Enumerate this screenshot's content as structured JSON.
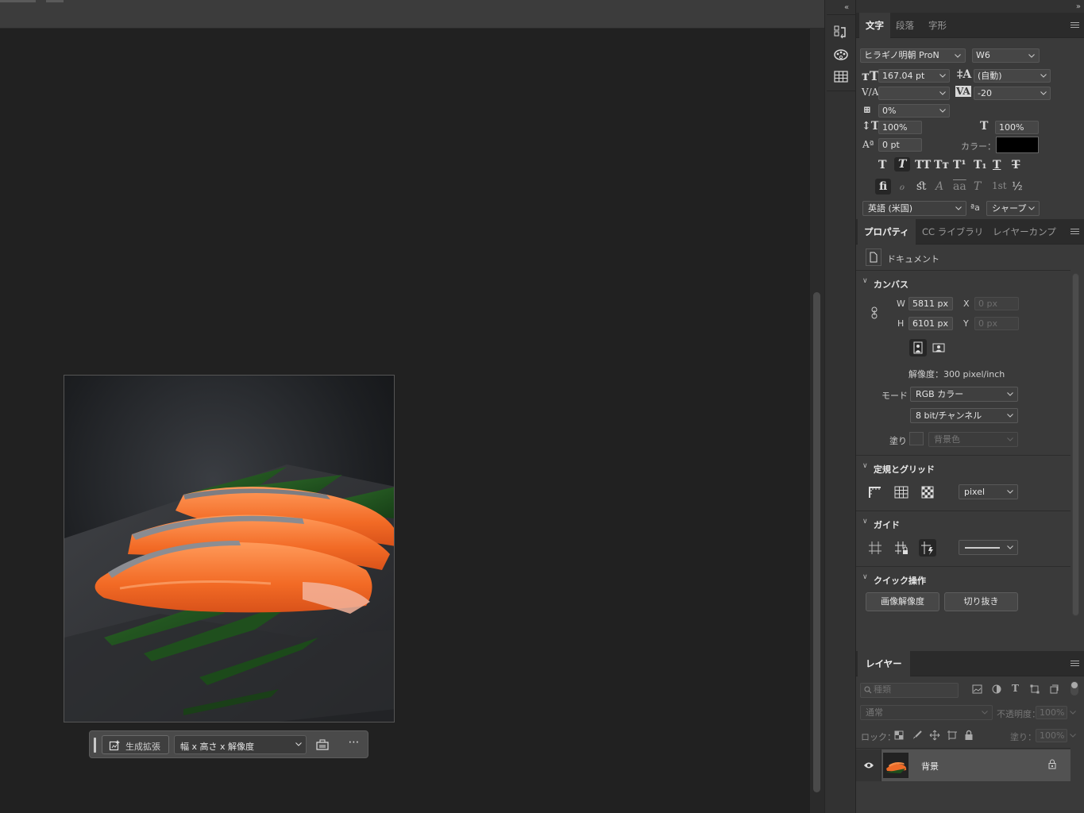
{
  "character_panel": {
    "tabs": [
      "文字",
      "段落",
      "字形"
    ],
    "font_family": "ヒラギノ明朝 ProN",
    "font_style": "W6",
    "font_size": "167.04 pt",
    "leading": "(自動)",
    "kerning": "",
    "tracking": "-20",
    "tsume": "0%",
    "vertical_scale": "100%",
    "horizontal_scale": "100%",
    "baseline_shift": "0 pt",
    "color_label": "カラー：",
    "color_value": "#000000",
    "language": "英語 (米国)",
    "antialias": "シャープ",
    "style_buttons": [
      "T",
      "T",
      "TT",
      "Tт",
      "T¹",
      "T₁",
      "T",
      "T"
    ],
    "opentype_buttons": [
      "ﬁ",
      "ℴ",
      "ﬆ",
      "A",
      "aa",
      "T",
      "1st",
      "½"
    ]
  },
  "properties_panel": {
    "tabs": [
      "プロパティ",
      "CC ライブラリ",
      "レイヤーカンプ"
    ],
    "document_label": "ドキュメント",
    "canvas": {
      "heading": "カンバス",
      "w_label": "W",
      "w_value": "5811 px",
      "h_label": "H",
      "h_value": "6101 px",
      "x_label": "X",
      "x_value": "0 px",
      "y_label": "Y",
      "y_value": "0 px",
      "resolution": "解像度：300 pixel/inch",
      "mode_label": "モード",
      "mode_value": "RGB カラー",
      "bit_depth": "8 bit/チャンネル",
      "fill_label": "塗り",
      "fill_value": "背景色"
    },
    "rulers": {
      "heading": "定規とグリッド",
      "unit": "pixel"
    },
    "guides": {
      "heading": "ガイド"
    },
    "quick_actions": {
      "heading": "クイック操作",
      "btn_image_size": "画像解像度",
      "btn_crop": "切り抜き"
    }
  },
  "layers_panel": {
    "tab": "レイヤー",
    "filter_placeholder": "種類",
    "blend_mode": "通常",
    "opacity_label": "不透明度：",
    "opacity_value": "100%",
    "lock_label": "ロック：",
    "fill_label": "塗り：",
    "fill_value": "100%",
    "layers": [
      {
        "name": "背景",
        "visible": true,
        "locked": true
      }
    ]
  },
  "task_bar": {
    "generative_expand": "生成拡張",
    "preset": "幅 x 高さ x 解像度",
    "more": "⋯"
  }
}
